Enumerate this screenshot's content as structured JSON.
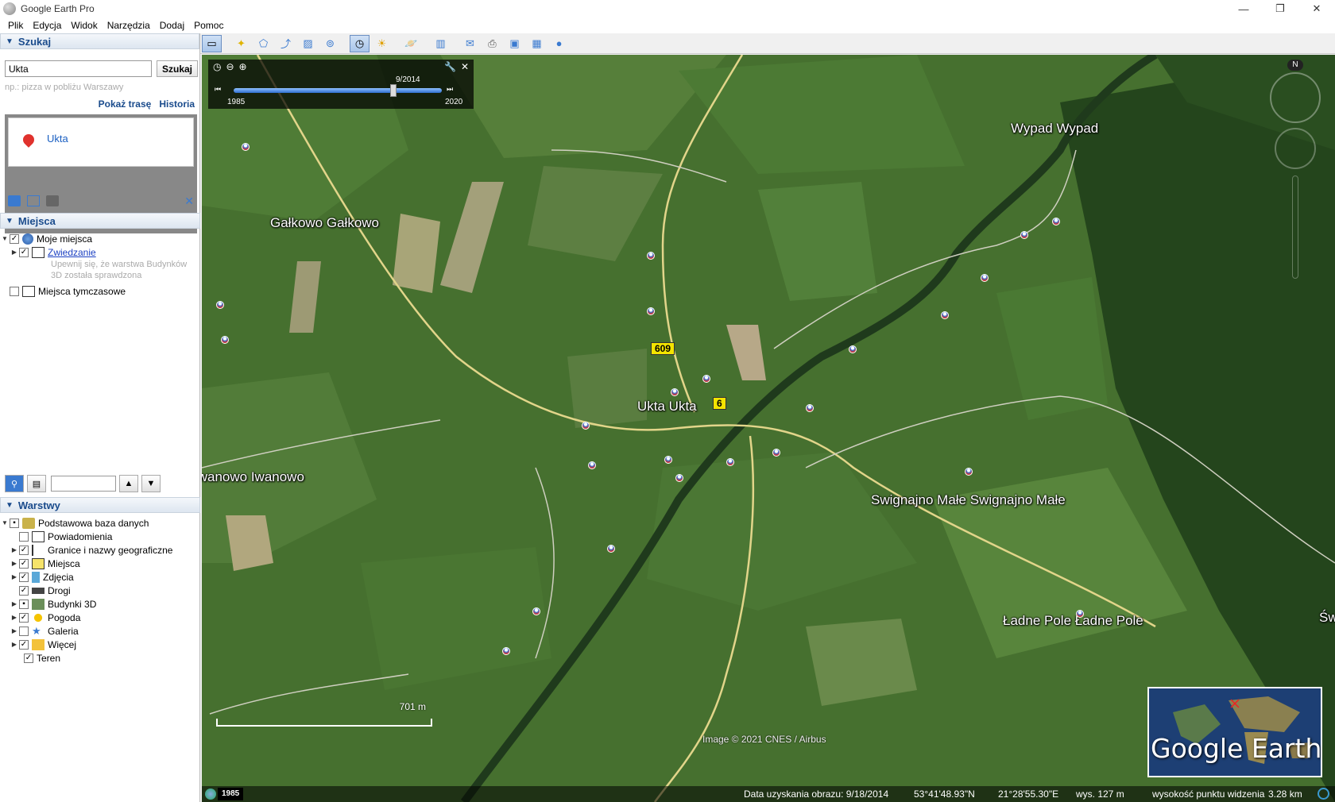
{
  "window": {
    "title": "Google Earth Pro",
    "controls": [
      "—",
      "❐",
      "✕"
    ]
  },
  "menu": [
    "Plik",
    "Edycja",
    "Widok",
    "Narzędzia",
    "Dodaj",
    "Pomoc"
  ],
  "search": {
    "header": "Szukaj",
    "value": "Ukta",
    "button": "Szukaj",
    "hint": "np.: pizza w pobliżu Warszawy",
    "link_route": "Pokaż trasę",
    "link_history": "Historia",
    "result": "Ukta"
  },
  "places": {
    "header": "Miejsca",
    "items": {
      "my_places": "Moje miejsca",
      "sightseeing": "Zwiedzanie",
      "note": "Upewnij się, że warstwa Budynków 3D została sprawdzona",
      "temporary": "Miejsca tymczasowe"
    }
  },
  "layers": {
    "header": "Warstwy",
    "root": "Podstawowa baza danych",
    "items": [
      "Powiadomienia",
      "Granice i nazwy geograficzne",
      "Miejsca",
      "Zdjęcia",
      "Drogi",
      "Budynki 3D",
      "Pogoda",
      "Galeria",
      "Więcej",
      "Teren"
    ]
  },
  "timeslider": {
    "date": "9/2014",
    "start": "1985",
    "end": "2020",
    "position": 0.766
  },
  "map": {
    "labels": {
      "galkowo": "Gałkowo  Gałkowo",
      "ukta": "Ukta  Ukta",
      "iwanowo": "Iwanowo  Iwanowo",
      "wypad": "Wypad  Wypad",
      "swignajno": "Swignajno Małe  Swignajno Małe",
      "ladne": "Ładne Pole  Ładne Pole",
      "sw": "Św"
    },
    "road_609": "609",
    "road_6x": "6",
    "scale": "701 m",
    "copyright": "Image © 2021 CNES / Airbus",
    "overview_logo": "Google Earth",
    "compass_n": "N"
  },
  "status": {
    "year": "1985",
    "date": "Data uzyskania obrazu: 9/18/2014",
    "lat": "53°41'48.93\"N",
    "lon": "21°28'55.30\"E",
    "elev": "wys.  127 m",
    "eye": "wysokość punktu widzenia",
    "eye_val": "3.28 km"
  }
}
